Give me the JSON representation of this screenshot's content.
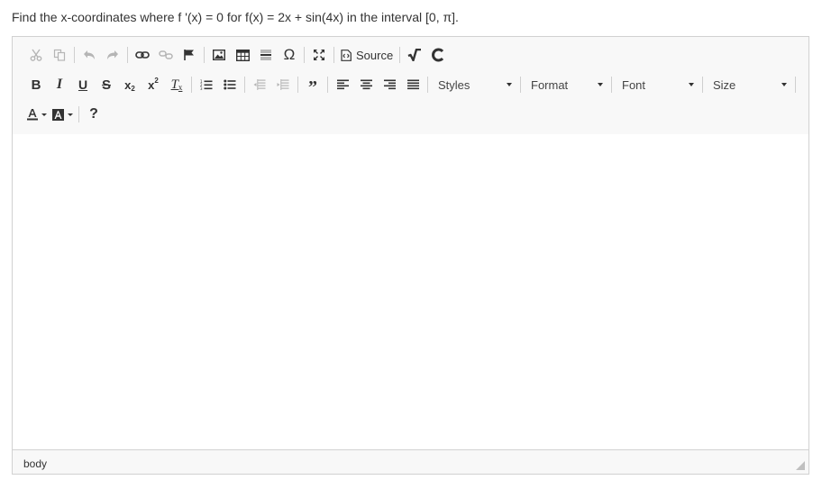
{
  "question": {
    "text": "Find the x-coordinates where f '(x) = 0 for f(x) = 2x + sin(4x) in the interval [0, π]."
  },
  "toolbar": {
    "source_label": "Source",
    "styles_label": "Styles",
    "format_label": "Format",
    "font_label": "Font",
    "size_label": "Size",
    "help_label": "?",
    "icons": [
      "cut-icon",
      "copy-icon",
      "undo-icon",
      "redo-icon",
      "link-icon",
      "unlink-icon",
      "anchor-flag-icon",
      "image-icon",
      "table-icon",
      "horizontal-rule-icon",
      "special-char-omega-icon",
      "maximize-icon",
      "source-icon",
      "sqrt-icon",
      "chem-c-icon",
      "bold-icon",
      "italic-icon",
      "underline-icon",
      "strike-icon",
      "subscript-icon",
      "superscript-icon",
      "remove-format-icon",
      "numbered-list-icon",
      "bulleted-list-icon",
      "outdent-icon",
      "indent-icon",
      "blockquote-icon",
      "align-left-icon",
      "align-center-icon",
      "align-right-icon",
      "justify-icon",
      "text-color-icon",
      "bg-color-icon"
    ]
  },
  "statusbar": {
    "path": "body"
  },
  "colors": {
    "border": "#d1d1d1",
    "toolbar_bg": "#f8f8f8",
    "disabled": "#b5b5b5"
  }
}
